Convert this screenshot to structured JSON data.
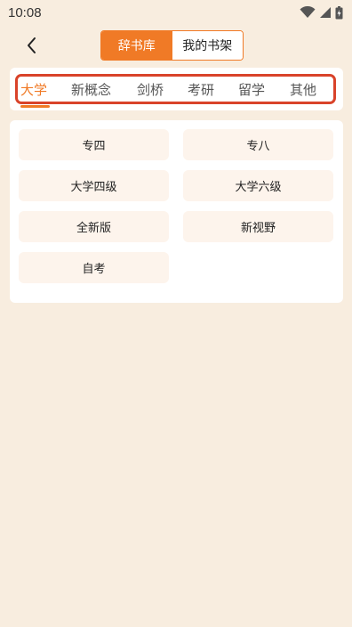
{
  "status_bar": {
    "time": "10:08",
    "icons": [
      "wifi-icon",
      "signal-icon",
      "battery-icon"
    ]
  },
  "header": {
    "back_icon": "chevron-left-icon",
    "segments": [
      {
        "label": "辞书库",
        "active": true
      },
      {
        "label": "我的书架",
        "active": false
      }
    ]
  },
  "category_tabs": [
    {
      "label": "大学",
      "active": true
    },
    {
      "label": "新概念",
      "active": false
    },
    {
      "label": "剑桥",
      "active": false
    },
    {
      "label": "考研",
      "active": false
    },
    {
      "label": "留学",
      "active": false
    },
    {
      "label": "其他",
      "active": false
    }
  ],
  "books": [
    {
      "label": "专四"
    },
    {
      "label": "专八"
    },
    {
      "label": "大学四级"
    },
    {
      "label": "大学六级"
    },
    {
      "label": "全新版"
    },
    {
      "label": "新视野"
    },
    {
      "label": "自考"
    }
  ],
  "colors": {
    "accent": "#F07A26",
    "highlight_outline": "#D9432A",
    "background": "#F8EDDF",
    "item_background": "#FDF4EC"
  }
}
